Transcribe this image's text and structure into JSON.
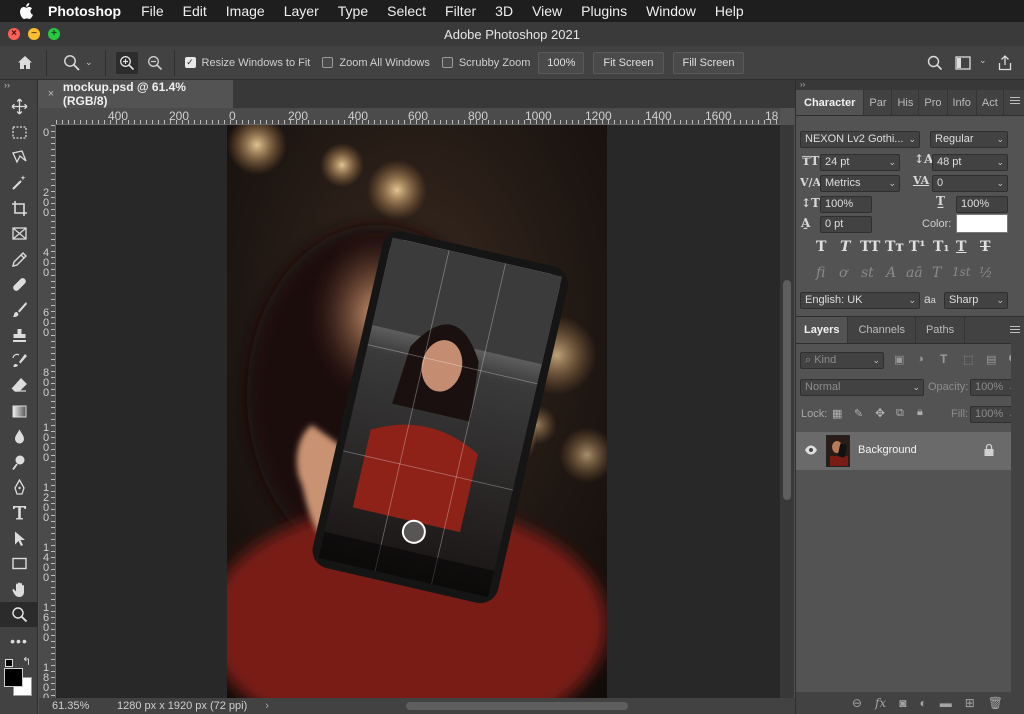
{
  "menubar": {
    "app_name": "Photoshop",
    "items": [
      "File",
      "Edit",
      "Image",
      "Layer",
      "Type",
      "Select",
      "Filter",
      "3D",
      "View",
      "Plugins",
      "Window",
      "Help"
    ]
  },
  "window": {
    "title": "Adobe Photoshop 2021"
  },
  "options": {
    "resize_windows": "Resize Windows to Fit",
    "zoom_all": "Zoom All Windows",
    "scrubby_zoom": "Scrubby Zoom",
    "zoom_value": "100%",
    "fit_screen": "Fit Screen",
    "fill_screen": "Fill Screen"
  },
  "document": {
    "tab_title": "mockup.psd @ 61.4% (RGB/8)",
    "close_glyph": "×"
  },
  "ruler": {
    "h_labels": [
      "400",
      "200",
      "0",
      "200",
      "400",
      "600",
      "800",
      "1000",
      "1200",
      "1400",
      "1600",
      "18"
    ],
    "v_labels": [
      "0",
      "200",
      "400",
      "600",
      "800",
      "1000",
      "1200",
      "1400",
      "1600",
      "1800"
    ]
  },
  "status": {
    "zoom": "61.35%",
    "info": "1280 px x 1920 px (72 ppi)",
    "arrow": "›"
  },
  "character": {
    "tabs": [
      "Character",
      "Par",
      "His",
      "Pro",
      "Info",
      "Act"
    ],
    "font_family": "NEXON Lv2 Gothi...",
    "font_style": "Regular",
    "font_size": "24 pt",
    "leading": "48 pt",
    "kerning": "Metrics",
    "tracking": "0",
    "vertical_scale": "100%",
    "horizontal_scale": "100%",
    "baseline_shift": "0 pt",
    "color_label": "Color:",
    "language": "English: UK",
    "aa_label": "a",
    "antialias": "Sharp",
    "style_glyphs": [
      "T",
      "T",
      "TT",
      "Tт",
      "T¹",
      "T₁",
      "T",
      "T"
    ],
    "opentype_glyphs": [
      "fi",
      "ơ",
      "st",
      "A",
      "aā",
      "T",
      "1st",
      "½"
    ],
    "color_value": "#ffffff"
  },
  "layers": {
    "tabs": [
      "Layers",
      "Channels",
      "Paths"
    ],
    "filter_kind": "Kind",
    "blend_mode": "Normal",
    "opacity_label": "Opacity:",
    "opacity_value": "100%",
    "lock_label": "Lock:",
    "fill_label": "Fill:",
    "fill_value": "100%",
    "items": [
      {
        "name": "Background",
        "locked": true,
        "visible": true
      }
    ]
  },
  "colors": {
    "accent_red": "#ff5f57",
    "accent_yellow": "#febc2e",
    "accent_green": "#28c840"
  }
}
